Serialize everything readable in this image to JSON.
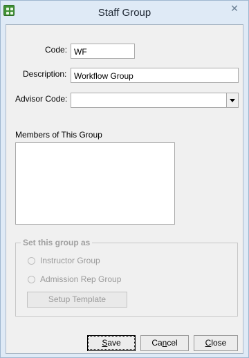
{
  "window": {
    "title": "Staff Group",
    "close_glyph": "✕"
  },
  "form": {
    "code_label": "Code:",
    "code_value": "WF",
    "description_label": "Description:",
    "description_value": "Workflow Group",
    "advisor_label": "Advisor Code:",
    "advisor_value": "",
    "members_label": "Members of This Group",
    "members": []
  },
  "group_settings": {
    "legend": "Set this group as",
    "options": [
      {
        "label": "Instructor Group",
        "checked": false,
        "enabled": false
      },
      {
        "label": "Admission Rep Group",
        "checked": false,
        "enabled": false
      }
    ],
    "setup_template_label": "Setup Template"
  },
  "buttons": {
    "save_first": "S",
    "save_rest": "ave",
    "cancel_pre": "Ca",
    "cancel_ul": "n",
    "cancel_post": "cel",
    "close_first": "C",
    "close_rest": "lose"
  },
  "icons": {
    "app": "app-grid-icon",
    "close": "close-icon",
    "dropdown": "chevron-down-icon"
  },
  "colors": {
    "titlebar": "#dfeaf6",
    "client_bg": "#f0f0f0",
    "disabled_text": "#9a9a9a"
  }
}
